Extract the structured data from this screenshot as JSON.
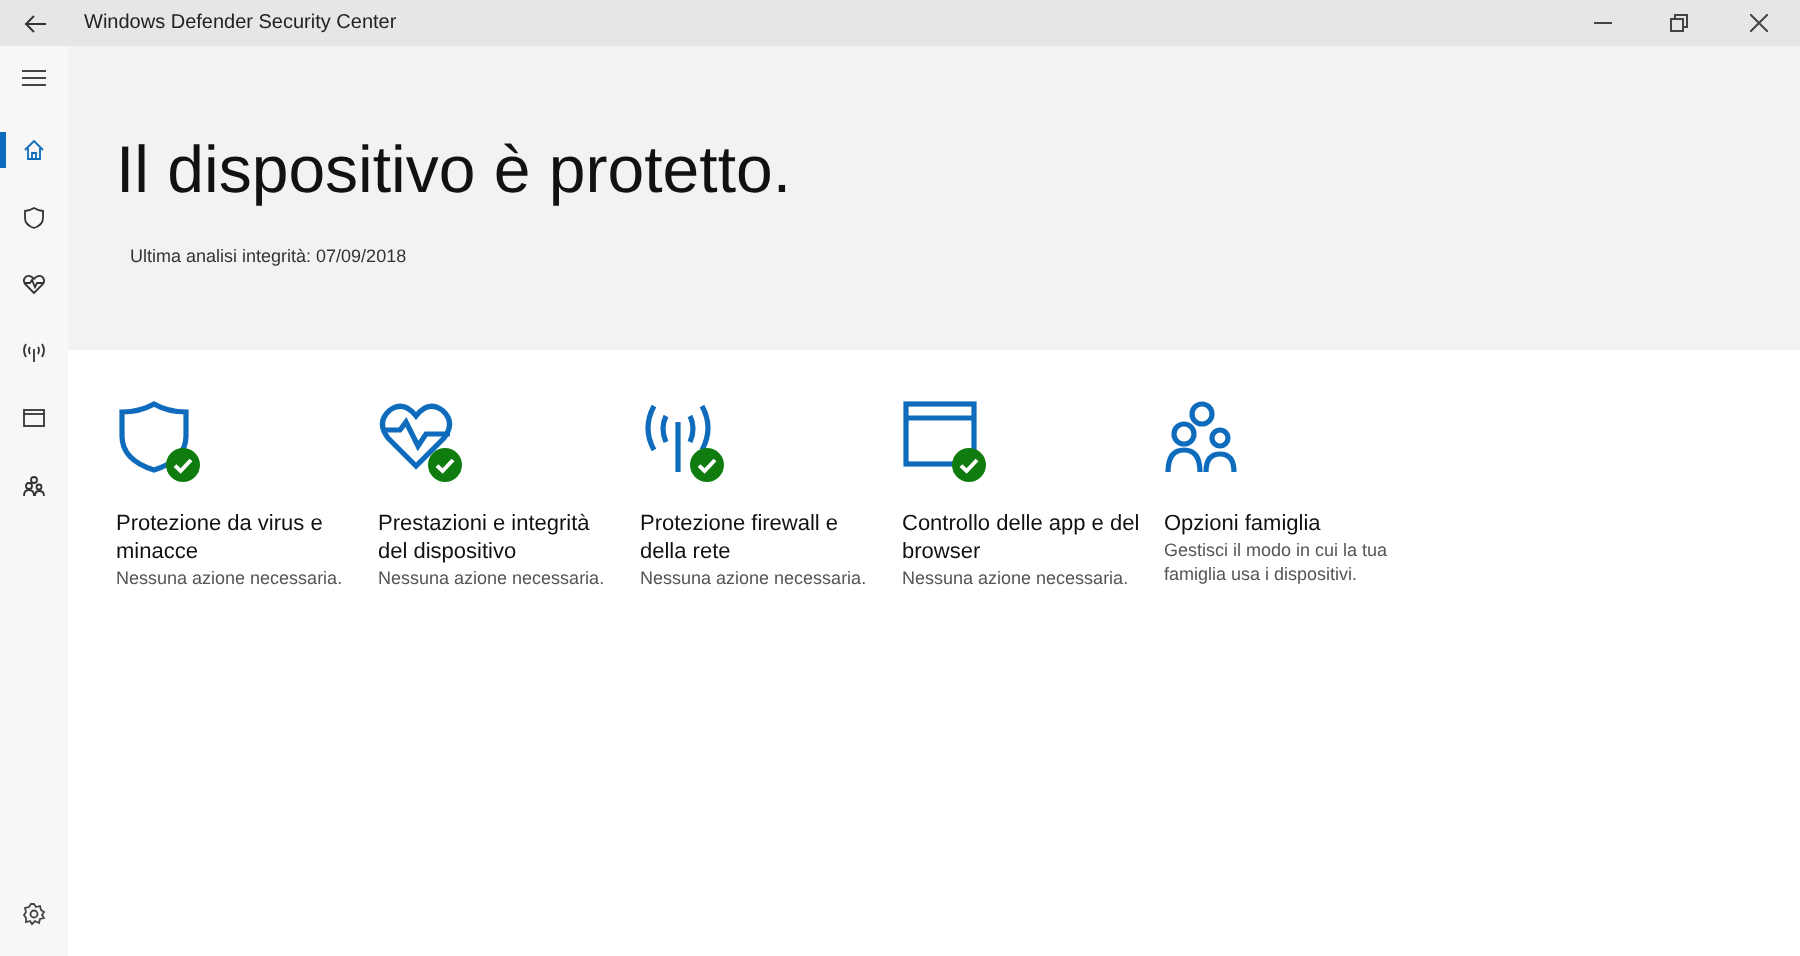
{
  "window": {
    "title": "Windows Defender Security Center"
  },
  "sidebar": {
    "items": [
      {
        "selected": true
      },
      {
        "selected": false
      },
      {
        "selected": false
      },
      {
        "selected": false
      },
      {
        "selected": false
      },
      {
        "selected": false
      }
    ]
  },
  "header": {
    "title": "Il dispositivo è protetto.",
    "subtitle": "Ultima analisi integrità: 07/09/2018"
  },
  "tiles": [
    {
      "title": "Protezione da virus e minacce",
      "description": "Nessuna azione necessaria.",
      "ok": true
    },
    {
      "title": "Prestazioni e integrità del dispositivo",
      "description": "Nessuna azione necessaria.",
      "ok": true
    },
    {
      "title": "Protezione firewall e della rete",
      "description": "Nessuna azione necessaria.",
      "ok": true
    },
    {
      "title": "Controllo delle app e del browser",
      "description": "Nessuna azione necessaria.",
      "ok": true
    },
    {
      "title": "Opzioni famiglia",
      "description": "Gestisci il modo in cui la tua famiglia usa i dispositivi.",
      "ok": false
    }
  ]
}
